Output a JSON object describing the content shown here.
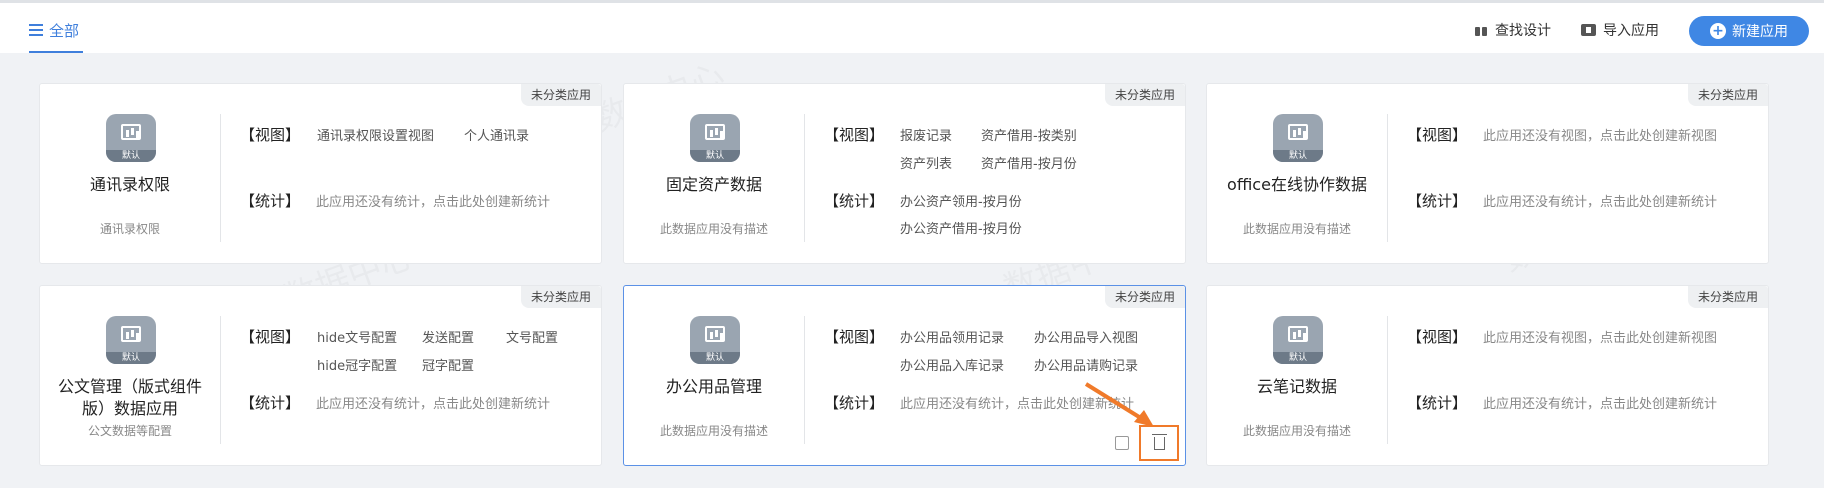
{
  "header": {
    "tab_all": "全部",
    "find_design": "查找设计",
    "import_app": "导入应用",
    "new_app": "新建应用"
  },
  "watermark": "数据中心",
  "labels": {
    "view": "【视图】",
    "stats": "【统计】",
    "icon_footer": "默认"
  },
  "cards": [
    {
      "tag": "未分类应用",
      "name": "通讯录权限",
      "desc": "通讯录权限",
      "views": [
        "通讯录权限设置视图",
        "个人通讯录"
      ],
      "stats": [],
      "stats_empty": "此应用还没有统计，点击此处创建新统计"
    },
    {
      "tag": "未分类应用",
      "name": "固定资产数据",
      "desc": "此数据应用没有描述",
      "views": [
        "报废记录",
        "资产借用-按类别",
        "资产列表",
        "资产借用-按月份"
      ],
      "stats": [
        "办公资产领用-按月份",
        "办公资产借用-按月份"
      ]
    },
    {
      "tag": "未分类应用",
      "name": "office在线协作数据",
      "desc": "此数据应用没有描述",
      "views_empty": "此应用还没有视图，点击此处创建新视图",
      "stats_empty": "此应用还没有统计，点击此处创建新统计"
    },
    {
      "tag": "未分类应用",
      "name": "公文管理（版式组件版）数据应用",
      "desc": "公文数据等配置",
      "views": [
        "hide文号配置",
        "发送配置",
        "文号配置",
        "hide冠字配置",
        "冠字配置"
      ],
      "stats_empty": "此应用还没有统计，点击此处创建新统计"
    },
    {
      "tag": "未分类应用",
      "name": "办公用品管理",
      "desc": "此数据应用没有描述",
      "views": [
        "办公用品领用记录",
        "办公用品导入视图",
        "办公用品入库记录",
        "办公用品请购记录"
      ],
      "stats_empty": "此应用还没有统计，点击此处创建新统计"
    },
    {
      "tag": "未分类应用",
      "name": "云笔记数据",
      "desc": "此数据应用没有描述",
      "views_empty": "此应用还没有视图，点击此处创建新视图",
      "stats_empty": "此应用还没有统计，点击此处创建新统计"
    }
  ],
  "colors": {
    "accent": "#3f87e4",
    "highlight": "#f07a2a"
  }
}
